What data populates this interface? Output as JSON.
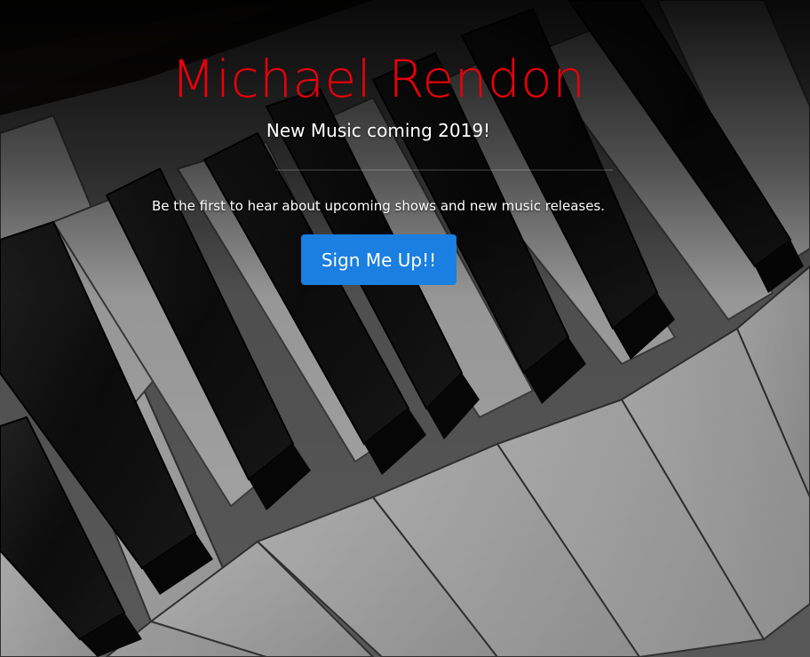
{
  "hero": {
    "title": "Michael Rendon",
    "subtitle": "New Music coming 2019!",
    "tagline": "Be the first to hear about upcoming shows and new music releases.",
    "signup_label": "Sign Me Up!!",
    "background_image": "piano-keys-photo"
  },
  "colors": {
    "title": "#e8000b",
    "text": "#ffffff",
    "button": "#1a7fe0"
  }
}
